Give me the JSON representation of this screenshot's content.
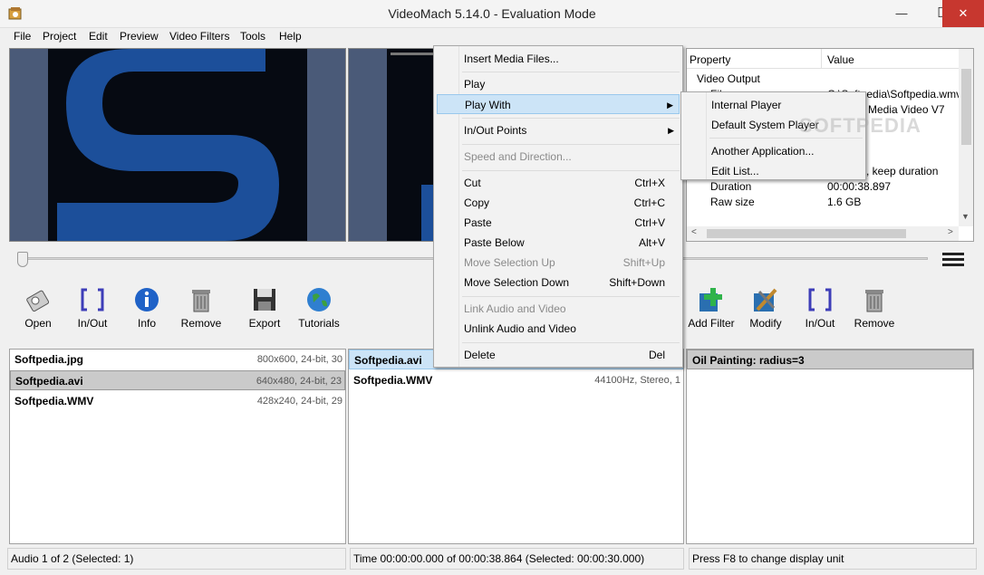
{
  "window": {
    "title": "VideoMach 5.14.0 - Evaluation Mode",
    "minimize": "—",
    "maximize": "☐",
    "close": "✕"
  },
  "menu": [
    "File",
    "Project",
    "Edit",
    "Preview",
    "Video Filters",
    "Tools",
    "Help"
  ],
  "properties": {
    "col_property": "Property",
    "col_value": "Value",
    "rows": [
      {
        "name": "Video Output",
        "value": ""
      },
      {
        "name": "File",
        "value": "C:\\Softpedia\\Softpedia.wmv"
      },
      {
        "name": "",
        "value": "Media Video V7"
      },
      {
        "name": "",
        "value": ", keep duration"
      },
      {
        "name": "Duration",
        "value": "00:00:38.897"
      },
      {
        "name": "Raw size",
        "value": "1.6 GB"
      }
    ]
  },
  "toolbar_left": [
    {
      "label": "Open",
      "icon": "open-icon"
    },
    {
      "label": "In/Out",
      "icon": "inout-icon"
    },
    {
      "label": "Info",
      "icon": "info-icon"
    },
    {
      "label": "Remove",
      "icon": "trash-icon"
    },
    {
      "label": "Export",
      "icon": "floppy-icon"
    },
    {
      "label": "Tutorials",
      "icon": "globe-icon"
    }
  ],
  "toolbar_right": [
    {
      "label": "Add Filter",
      "icon": "add-filter-icon"
    },
    {
      "label": "Modify",
      "icon": "tools-icon"
    },
    {
      "label": "In/Out",
      "icon": "inout-icon"
    },
    {
      "label": "Remove",
      "icon": "trash-icon"
    }
  ],
  "images_list": [
    {
      "name": "Softpedia.jpg",
      "meta": "800x600, 24-bit, 30"
    },
    {
      "name": "Softpedia.avi",
      "meta": "640x480, 24-bit, 23"
    },
    {
      "name": "Softpedia.WMV",
      "meta": "428x240, 24-bit, 29"
    }
  ],
  "audio_list": [
    {
      "name": "Softpedia.avi",
      "meta": ""
    },
    {
      "name": "Softpedia.WMV",
      "meta": "44100Hz, Stereo, 1"
    }
  ],
  "filters_list": [
    {
      "name": "Oil Painting:  radius=3"
    }
  ],
  "status": {
    "left": "Audio 1 of 2  (Selected: 1)",
    "middle": "Time 00:00:00.000 of 00:00:38.864  (Selected: 00:00:30.000)",
    "right": "Press F8 to change display unit"
  },
  "context_menu": {
    "items": [
      {
        "label": "Insert Media Files...",
        "shortcut": "",
        "disabled": false
      },
      {
        "label": "Play",
        "shortcut": "",
        "disabled": false
      },
      {
        "label": "Play With",
        "shortcut": "",
        "disabled": false
      },
      {
        "label": "In/Out Points",
        "shortcut": "",
        "disabled": false
      },
      {
        "label": "Speed and Direction...",
        "shortcut": "",
        "disabled": true
      },
      {
        "label": "Cut",
        "shortcut": "Ctrl+X",
        "disabled": false
      },
      {
        "label": "Copy",
        "shortcut": "Ctrl+C",
        "disabled": false
      },
      {
        "label": "Paste",
        "shortcut": "Ctrl+V",
        "disabled": false
      },
      {
        "label": "Paste Below",
        "shortcut": "Alt+V",
        "disabled": false
      },
      {
        "label": "Move Selection Up",
        "shortcut": "Shift+Up",
        "disabled": true
      },
      {
        "label": "Move Selection Down",
        "shortcut": "Shift+Down",
        "disabled": false
      },
      {
        "label": "Link Audio and Video",
        "shortcut": "",
        "disabled": true
      },
      {
        "label": "Unlink Audio and Video",
        "shortcut": "",
        "disabled": false
      },
      {
        "label": "Delete",
        "shortcut": "Del",
        "disabled": false
      }
    ]
  },
  "submenu": [
    "Internal Player",
    "Default System Player",
    "Another Application...",
    "Edit List..."
  ],
  "watermark": "SOFTPEDIA"
}
